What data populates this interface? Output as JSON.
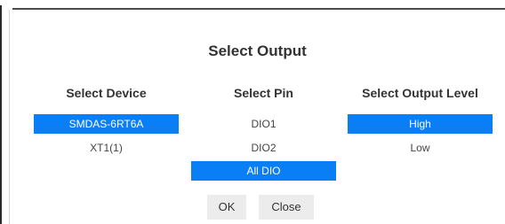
{
  "dialog": {
    "title": "Select Output"
  },
  "columns": {
    "device": {
      "header": "Select Device",
      "options": [
        "SMDAS-6RT6A",
        "XT1(1)"
      ],
      "selected": "SMDAS-6RT6A"
    },
    "pin": {
      "header": "Select Pin",
      "options": [
        "DIO1",
        "DIO2",
        "All DIO"
      ],
      "selected": "All DIO"
    },
    "level": {
      "header": "Select Output Level",
      "options": [
        "High",
        "Low"
      ],
      "selected": "High"
    }
  },
  "buttons": {
    "ok": "OK",
    "close": "Close"
  },
  "colors": {
    "selection": "#0a7ef5",
    "button_bg": "#ececec"
  }
}
